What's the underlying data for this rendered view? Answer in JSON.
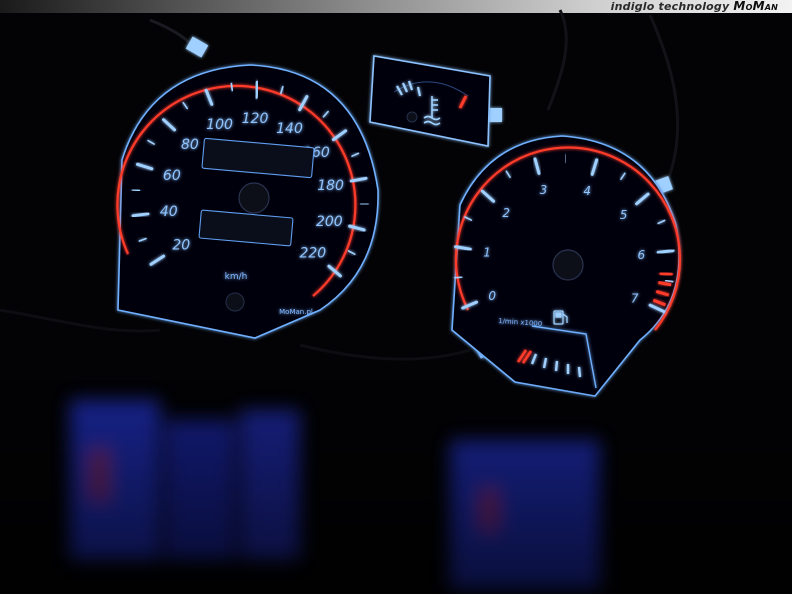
{
  "banner": {
    "text": "indiglo technology",
    "brand": "MoMan"
  },
  "colors": {
    "background": "#030305",
    "glow_blue": "#5aa0ff",
    "glow_red": "#ff3b2a",
    "dial_face": "#050610"
  },
  "speedometer": {
    "labels": [
      "20",
      "40",
      "60",
      "80",
      "100",
      "120",
      "140",
      "160",
      "180",
      "200",
      "220"
    ],
    "unit": "km/h",
    "maker": "MoMan.pl"
  },
  "tachometer": {
    "labels": [
      "0",
      "1",
      "2",
      "3",
      "4",
      "5",
      "6",
      "7"
    ],
    "unit": "1/min x1000",
    "fuel_icon": "fuel-pump-icon"
  },
  "temp_gauge": {
    "icon": "coolant-temperature-icon"
  }
}
